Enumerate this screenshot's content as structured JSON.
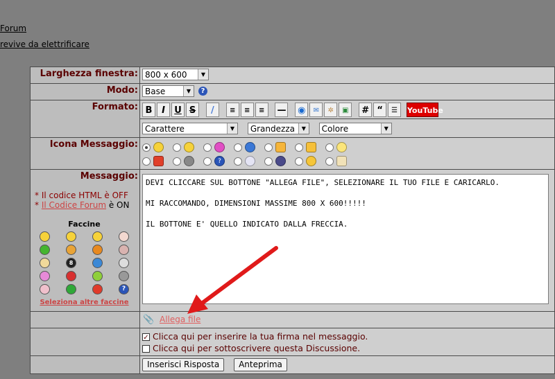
{
  "top_links": [
    "Forum",
    "revive da elettrificare"
  ],
  "rows": {
    "larghezza": {
      "label": "Larghezza finestra:",
      "value": "800 x 600"
    },
    "modo": {
      "label": "Modo:",
      "value": "Base"
    },
    "formato": {
      "label": "Formato:",
      "youtube": "YouTube",
      "carattere": "Carattere",
      "grandezza": "Grandezza",
      "colore": "Colore"
    },
    "icona": {
      "label": "Icona Messaggio:"
    },
    "messaggio": {
      "label": "Messaggio:",
      "html_note": "* Il codice HTML è OFF",
      "forum_note_prefix": "* ",
      "forum_link": "Il Codice Forum",
      "forum_note_suffix": " è ON",
      "faccine_title": "Faccine",
      "altre_faccine": "Seleziona altre faccine",
      "text": "DEVI CLICCARE SUL BOTTONE \"ALLEGA FILE\", SELEZIONARE IL TUO FILE E CARICARLO.\n\nMI RACCOMANDO, DIMENSIONI MASSIME 800 X 600!!!!!\n\nIL BOTTONE E' QUELLO INDICATO DALLA FRECCIA."
    },
    "allega": {
      "label": "Allega file"
    },
    "firma": {
      "label": "Clicca qui per inserire la tua firma nel messaggio.",
      "checked": true
    },
    "sottoscrivi": {
      "label": "Clicca qui per sottoscrivere questa Discussione.",
      "checked": false
    },
    "buttons": {
      "inserisci": "Inserisci Risposta",
      "anteprima": "Anteprima"
    }
  }
}
